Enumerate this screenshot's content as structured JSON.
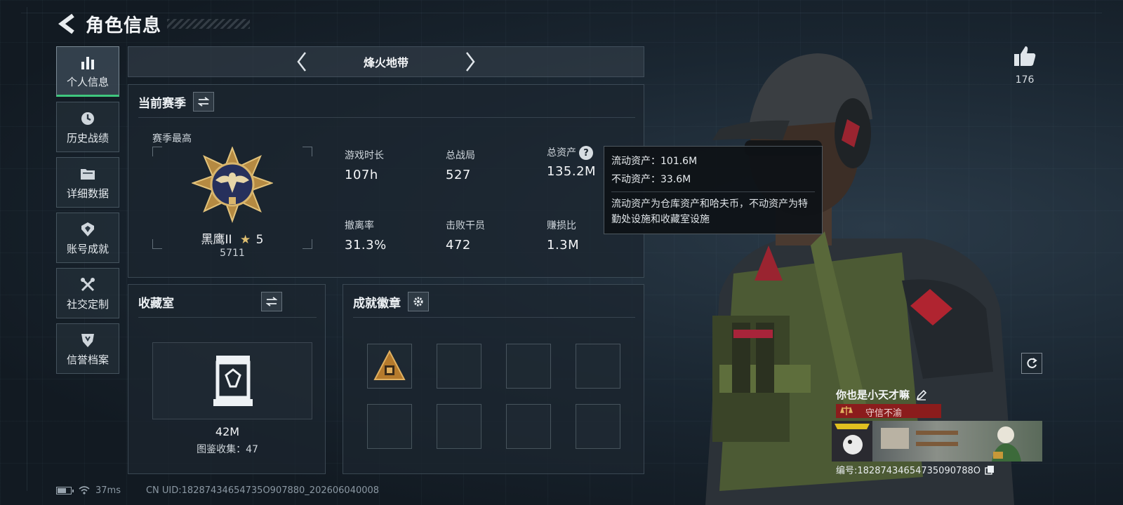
{
  "header": {
    "title": "角色信息"
  },
  "sidebar": {
    "items": [
      {
        "label": "个人信息",
        "icon": "bar-chart-icon",
        "active": true
      },
      {
        "label": "历史战绩",
        "icon": "history-clock-icon"
      },
      {
        "label": "详细数据",
        "icon": "folder-icon"
      },
      {
        "label": "账号成就",
        "icon": "achievement-icon"
      },
      {
        "label": "社交定制",
        "icon": "tools-icon"
      },
      {
        "label": "信誉档案",
        "icon": "shield-icon"
      }
    ]
  },
  "mode_selector": {
    "label": "烽火地带"
  },
  "season": {
    "title": "当前赛季",
    "best_label": "赛季最高",
    "rank_name": "黑鹰II",
    "rank_stars": "5",
    "rank_score": "5711",
    "stats": [
      {
        "label": "游戏时长",
        "value": "107h"
      },
      {
        "label": "总战局",
        "value": "527"
      },
      {
        "label": "总资产",
        "value": "135.2M",
        "help": "?"
      },
      {
        "label": "撤离率",
        "value": "31.3%"
      },
      {
        "label": "击败干员",
        "value": "472"
      },
      {
        "label": "赚损比",
        "value": "1.3M"
      }
    ]
  },
  "tooltip": {
    "liquid": "流动资产：101.6M",
    "fixed": "不动资产：33.6M",
    "description": "流动资产为仓库资产和哈夫币，不动资产为特勤处设施和收藏室设施"
  },
  "collection": {
    "title": "收藏室",
    "value": "42M",
    "count_text": "图鉴收集：47"
  },
  "achievements": {
    "title": "成就徽章"
  },
  "likes": {
    "count": "176"
  },
  "namecard": {
    "player_name": "你也是小天才嘛",
    "title_text": "守信不渝",
    "id_text": "编号:18287434654735090788O"
  },
  "footer": {
    "ping": "37ms",
    "uid": "CN UID:18287434654735O907880_202606040008"
  },
  "colors": {
    "active_underline": "#3fc77e",
    "title_bar": "#8b1c1c",
    "background": "#141d25"
  }
}
